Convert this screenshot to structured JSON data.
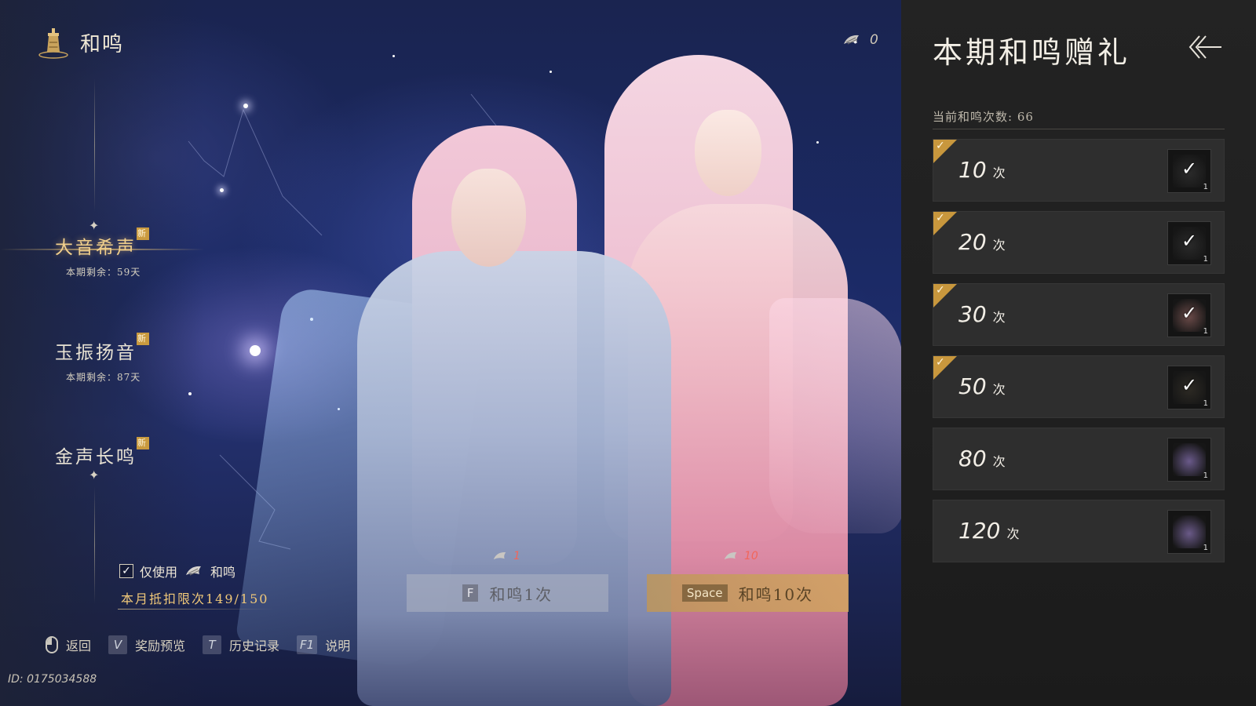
{
  "header": {
    "title": "和鸣",
    "icon": "bell-icon"
  },
  "currency": {
    "icon": "token-icon",
    "count": "0"
  },
  "banners": [
    {
      "name": "大音希声",
      "badge": "新",
      "remaining": "本期剩余：59天",
      "active": true
    },
    {
      "name": "玉振扬音",
      "badge": "新",
      "remaining": "本期剩余：87天",
      "active": false
    },
    {
      "name": "金声长鸣",
      "badge": "新",
      "remaining": "",
      "active": false
    }
  ],
  "options": {
    "only_use_label": "仅使用",
    "only_use_suffix": "和鸣",
    "checked": true,
    "check_mark": "✓"
  },
  "quota": {
    "text": "本月抵扣限次149/150"
  },
  "draw": {
    "single": {
      "key": "F",
      "label": "和鸣1次",
      "cost": "1"
    },
    "ten": {
      "key": "Space",
      "label": "和鸣10次",
      "cost": "10"
    }
  },
  "hints": [
    {
      "key": "",
      "icon": "mouse-icon",
      "label": "返回"
    },
    {
      "key": "V",
      "label": "奖励预览"
    },
    {
      "key": "T",
      "label": "历史记录"
    },
    {
      "key": "F1",
      "label": "说明"
    }
  ],
  "player_id": "ID: 0175034588",
  "reward_panel": {
    "title": "本期和鸣赠礼",
    "count_label": "当前和鸣次数: 66",
    "unit": "次",
    "check_mark": "✓",
    "rewards": [
      {
        "count": "10",
        "claimed": true,
        "qty": "1",
        "color": "#2b2b2b"
      },
      {
        "count": "20",
        "claimed": true,
        "qty": "1",
        "color": "#2a2a2a"
      },
      {
        "count": "30",
        "claimed": true,
        "qty": "1",
        "color": "#6a4a48"
      },
      {
        "count": "50",
        "claimed": true,
        "qty": "1",
        "color": "#2d2a24"
      },
      {
        "count": "80",
        "claimed": false,
        "qty": "1",
        "color": "#6a5a8a"
      },
      {
        "count": "120",
        "claimed": false,
        "qty": "1",
        "color": "#6a5a88"
      }
    ]
  },
  "colors": {
    "accent_gold": "#c8973d",
    "active_banner": "#f0cf8c",
    "cost_red": "#f2665b",
    "panel_bg": "#232323"
  }
}
